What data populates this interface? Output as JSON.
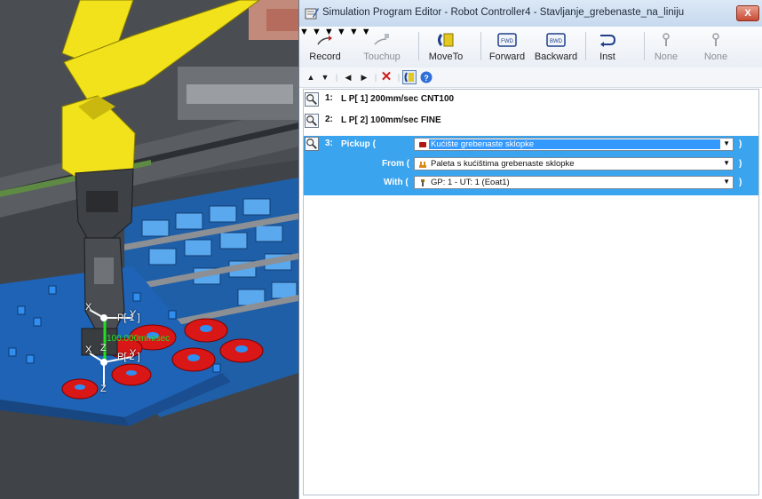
{
  "viewport": {
    "labels": {
      "p1": "P[ 1 ]",
      "p2": "P[ 2 ]",
      "x_axis_1": "X",
      "y_axis_1": "Y",
      "x_axis_2": "X",
      "y_axis_2": "Y",
      "z_axis_1": "Z",
      "z_axis_2": "Z",
      "speed": "100.000mm/sec"
    },
    "colors": {
      "robot": "#f2e21c",
      "table": "#1f66b8",
      "parts": "#e01919",
      "background": "#404448"
    }
  },
  "window": {
    "title": "Simulation Program Editor - Robot Controller4 - Stavljanje_grebenaste_na_liniju",
    "close_label": "X"
  },
  "toolbar": {
    "record": "Record",
    "touchup": "Touchup",
    "moveto": "MoveTo",
    "forward": "Forward",
    "backward": "Backward",
    "inst": "Inst",
    "none1": "None",
    "none2": "None",
    "fwd_icon_text": "FWD",
    "bwd_icon_text": "BWD"
  },
  "program": {
    "lines": [
      {
        "num": "1:",
        "text": "L P[ 1] 200mm/sec  CNT100"
      },
      {
        "num": "2:",
        "text": "L P[ 2] 100mm/sec  FINE"
      }
    ],
    "pickup": {
      "num": "3:",
      "keyword": "Pickup (",
      "value": "Kućište grebenaste sklopke",
      "from_label": "From (",
      "from_value": "Paleta s kućištima grebenaste sklopke",
      "with_label": "With (",
      "with_value": "GP: 1 - UT: 1  (Eoat1)",
      "close_paren": ")"
    }
  }
}
